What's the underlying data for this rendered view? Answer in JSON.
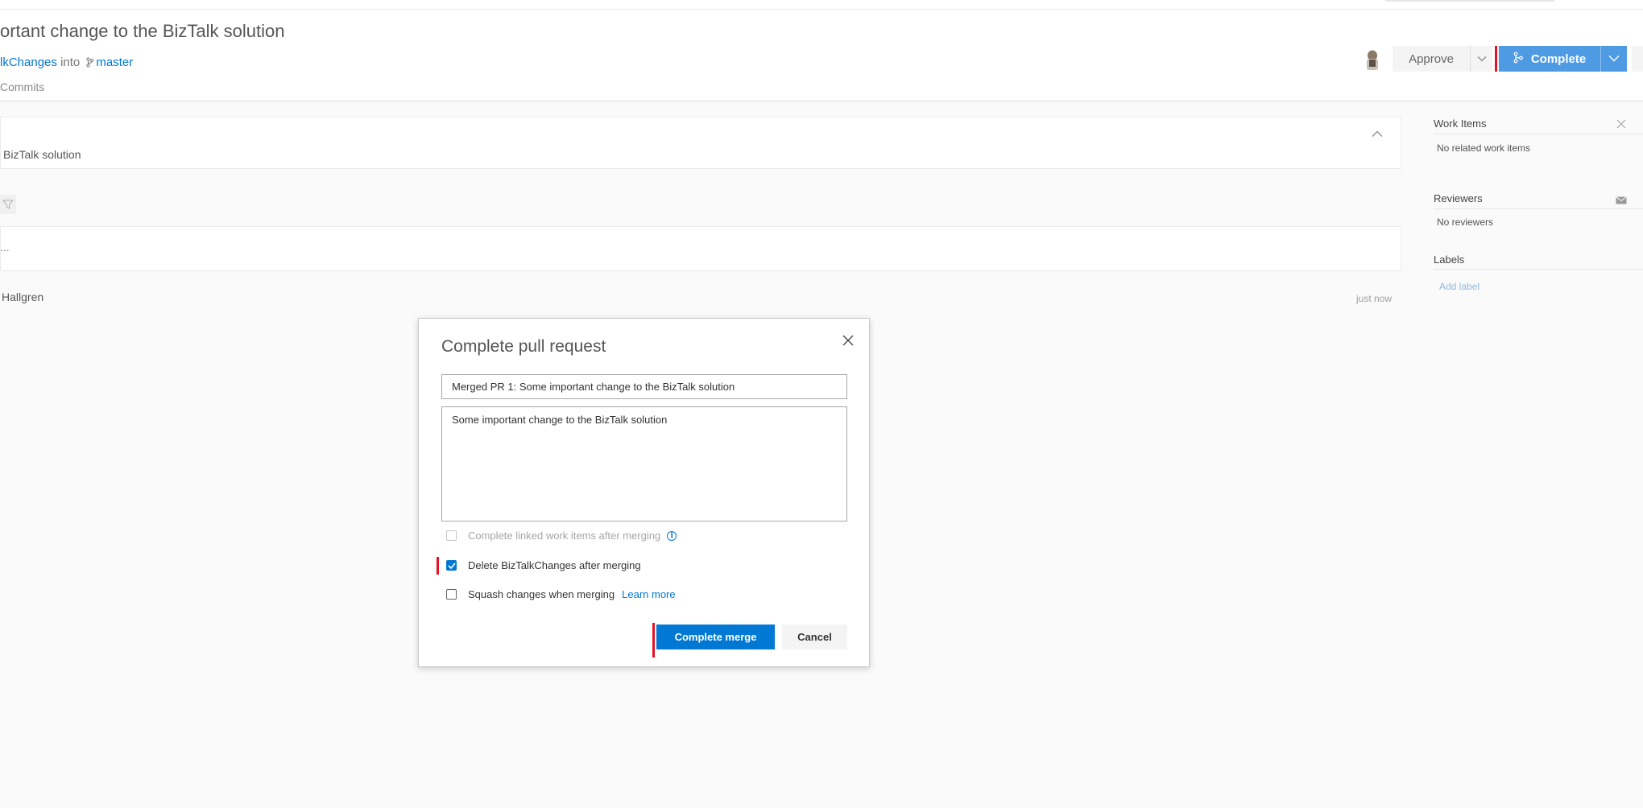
{
  "pr": {
    "title": "ortant change to the BizTalk solution",
    "source_branch": "lkChanges",
    "into_word": "into",
    "target_branch": "master",
    "tab": "Commits"
  },
  "header": {
    "approve_label": "Approve",
    "complete_label": "Complete"
  },
  "main": {
    "description_text": "BizTalk solution",
    "comment_ellipsis": "...",
    "author": "Hallgren",
    "timestamp": "just now"
  },
  "sidebar": {
    "work_items": {
      "heading": "Work Items",
      "empty_text": "No related work items"
    },
    "reviewers": {
      "heading": "Reviewers",
      "empty_text": "No reviewers"
    },
    "labels": {
      "heading": "Labels",
      "add_label": "Add label"
    }
  },
  "dialog": {
    "title": "Complete pull request",
    "merge_title_value": "Merged PR 1: Some important change to the BizTalk solution",
    "merge_description_value": "Some important change to the BizTalk solution",
    "options": {
      "complete_work_items": {
        "label": "Complete linked work items after merging",
        "checked": false,
        "disabled": true
      },
      "delete_branch": {
        "label": "Delete BizTalkChanges after merging",
        "checked": true
      },
      "squash": {
        "label": "Squash changes when merging",
        "checked": false,
        "learn_more": "Learn more"
      }
    },
    "complete_merge_label": "Complete merge",
    "cancel_label": "Cancel"
  },
  "colors": {
    "accent": "#0078d4",
    "complete_button": "#4f9be3",
    "highlight_marker": "#e81123"
  },
  "icons": [
    "branch-icon",
    "chevron-down-icon",
    "chevron-up-icon",
    "filter-icon",
    "close-icon",
    "mail-icon",
    "info-icon",
    "checkmark-icon",
    "avatar"
  ]
}
